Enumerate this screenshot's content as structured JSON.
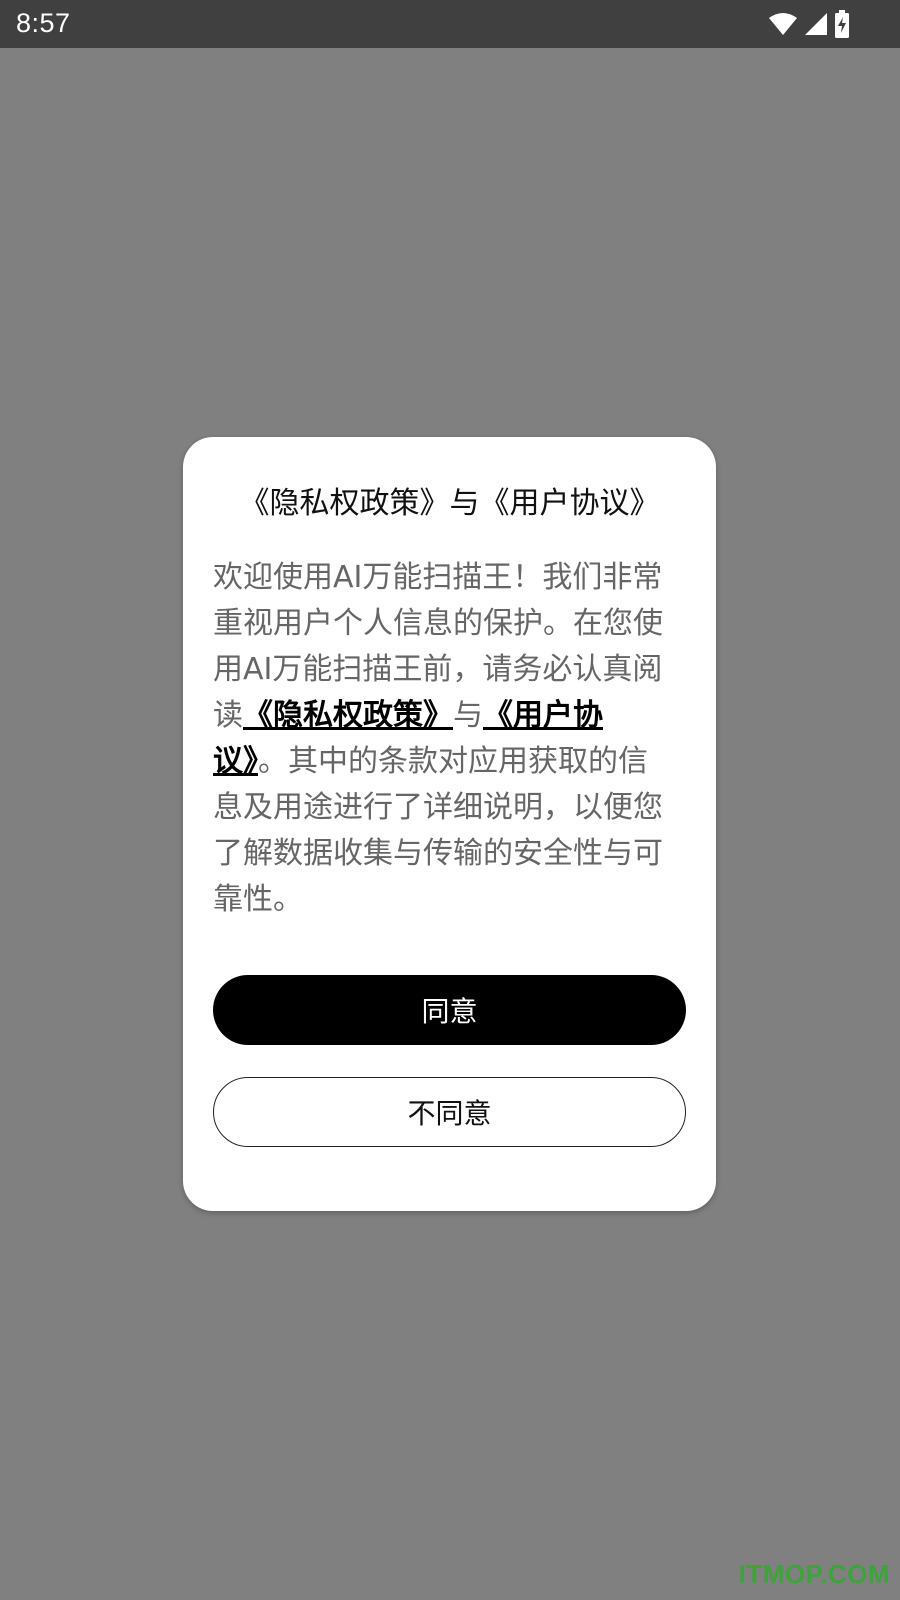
{
  "status_bar": {
    "time": "8:57",
    "icons": [
      "wifi-icon",
      "cellular-signal-icon",
      "battery-charging-icon"
    ]
  },
  "dialog": {
    "title": "《隐私权政策》与《用户协议》",
    "body": {
      "intro": "欢迎使用AI万能扫描王！我们非常重视用户个人信息的保护。在您使用AI万能扫描王前，请务必认真阅读",
      "privacy_link": "《隐私权政策》",
      "joiner": "与",
      "agreement_link": "《用户协议》",
      "outro": "。其中的条款对应用获取的信息及用途进行了详细说明，以便您了解数据收集与传输的安全性与可靠性。"
    },
    "agree_label": "同意",
    "disagree_label": "不同意"
  },
  "watermark": "ITMOP.COM",
  "colors": {
    "backdrop": "#808080",
    "status_bar": "#404040",
    "agree_button": "#000000",
    "watermark": "#3ea33b"
  }
}
